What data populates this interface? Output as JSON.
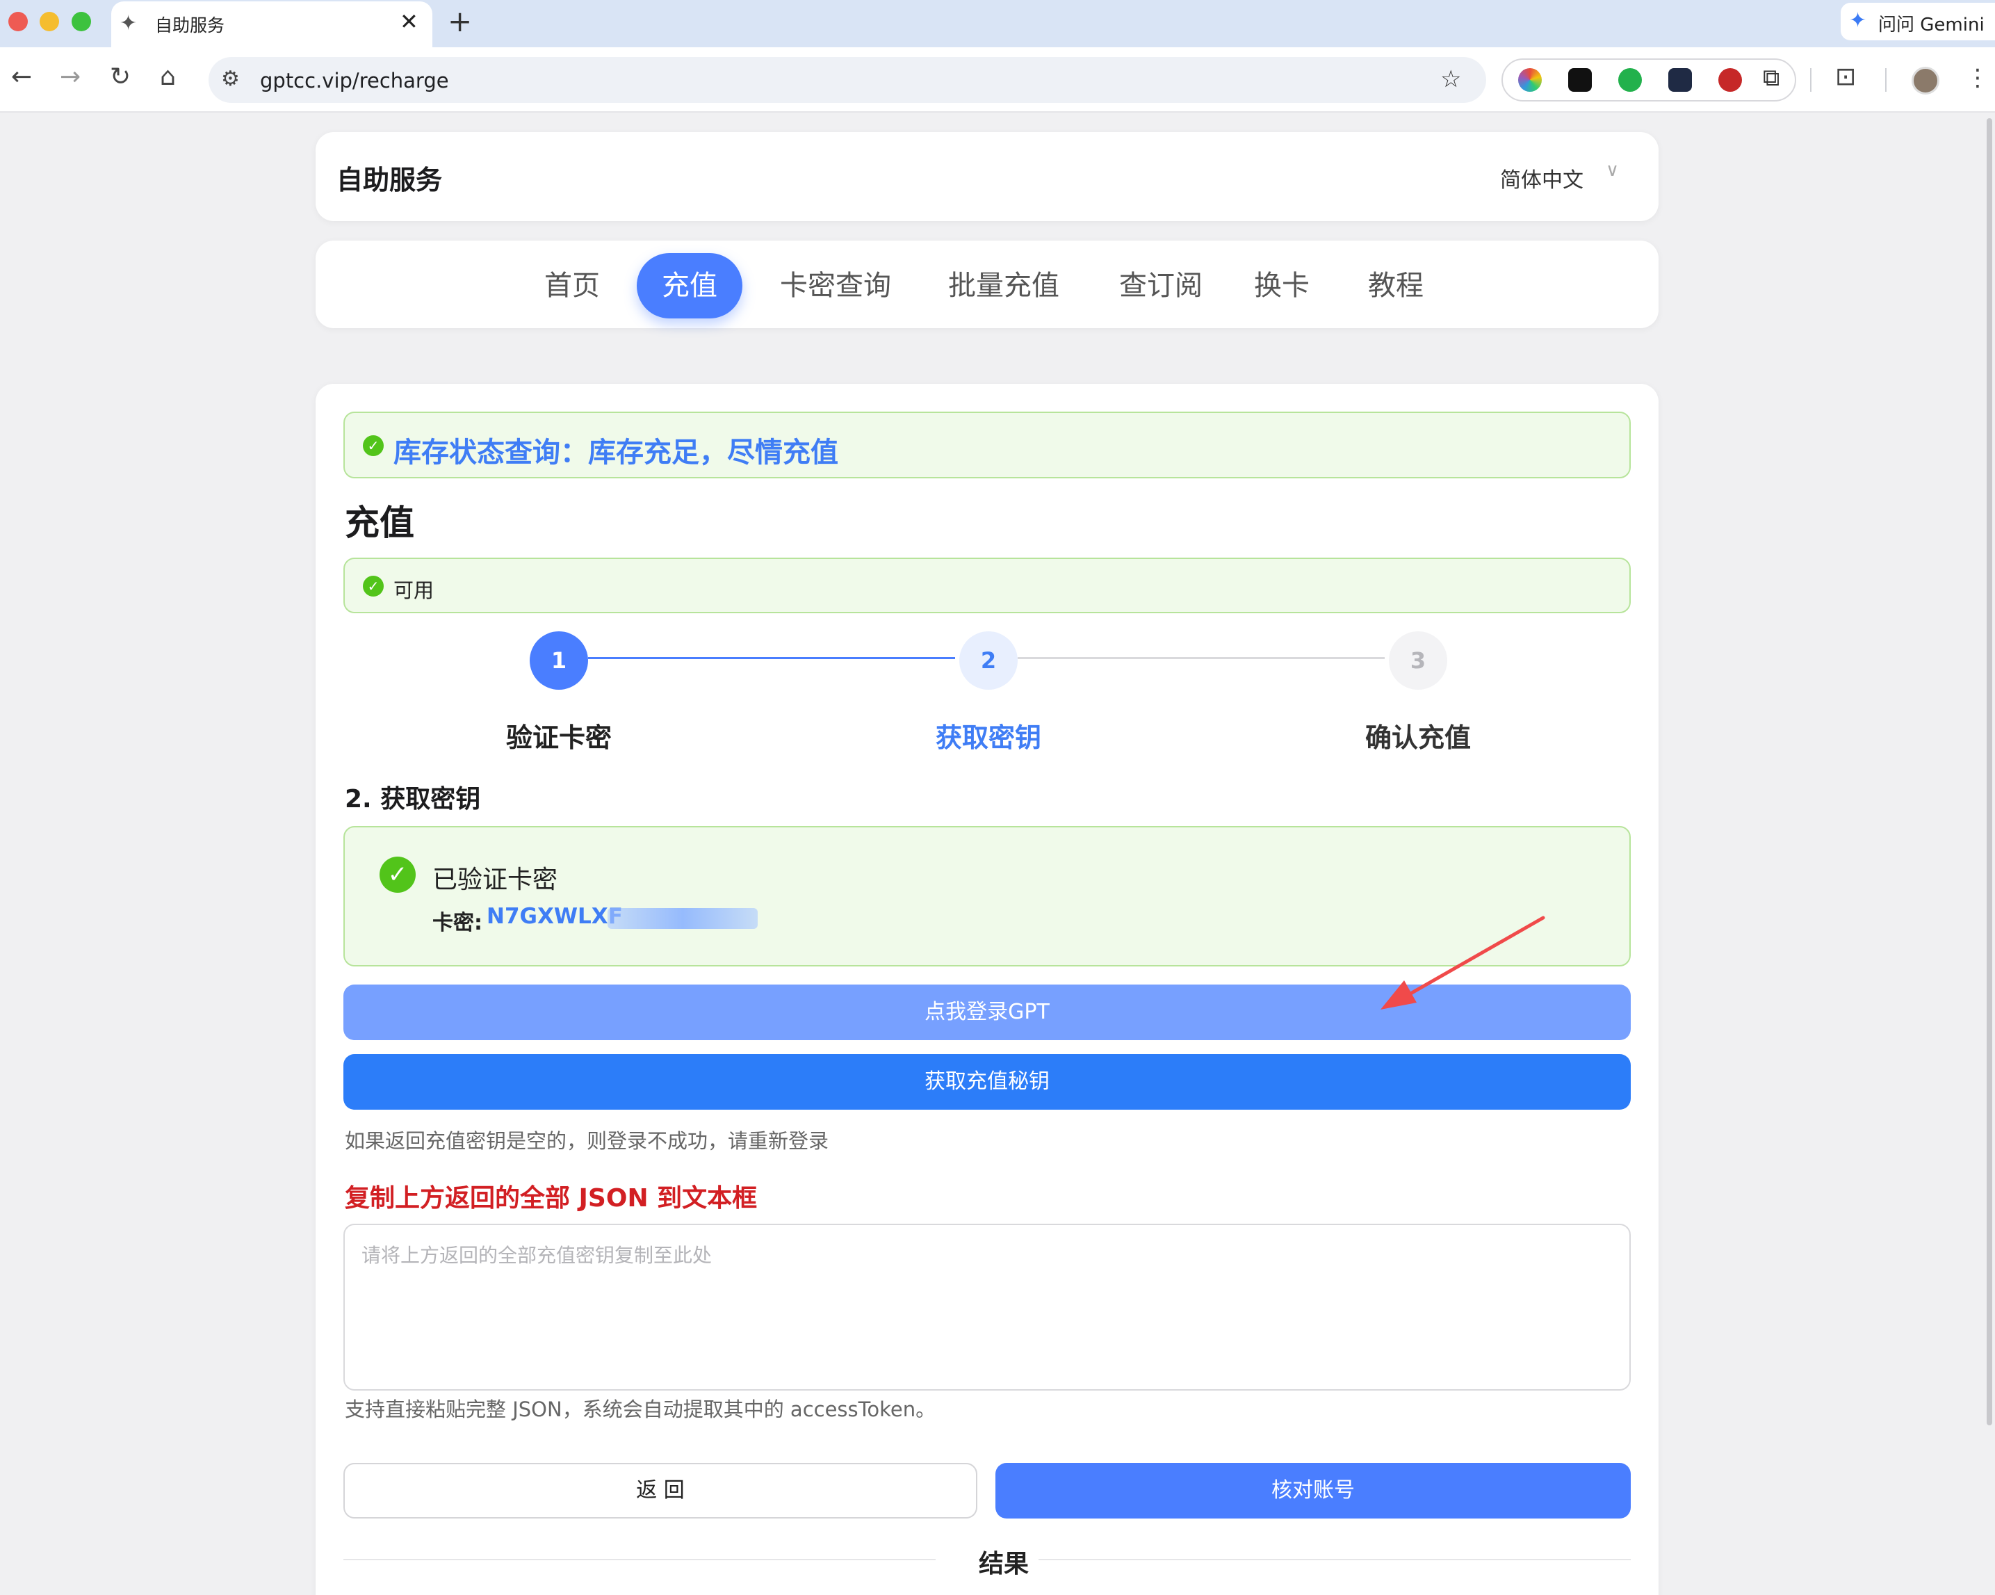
{
  "browser": {
    "tab_title": "自助服务",
    "tab_favicon": "✦",
    "close_glyph": "✕",
    "new_tab_glyph": "+",
    "gemini_label": "问问 Gemini",
    "url": "gptcc.vip/recharge",
    "icons": {
      "back": "←",
      "forward": "→",
      "reload": "↻",
      "home": "⌂",
      "site_info": "⚙",
      "bookmark": "☆",
      "extensions": "⧉",
      "reading_mode": "⊡",
      "menu": "⋮"
    }
  },
  "header": {
    "title": "自助服务",
    "language": "简体中文",
    "caret": "∨"
  },
  "nav": {
    "items": [
      "首页",
      "充值",
      "卡密查询",
      "批量充值",
      "查订阅",
      "换卡",
      "教程"
    ],
    "active_index": 1
  },
  "stock_alert": {
    "text": "库存状态查询：库存充足，尽情充值"
  },
  "section_title": "充值",
  "availability": {
    "text": "可用"
  },
  "steps": {
    "current": 2,
    "items": [
      {
        "number": "1",
        "label": "验证卡密"
      },
      {
        "number": "2",
        "label": "获取密钥"
      },
      {
        "number": "3",
        "label": "确认充值"
      }
    ]
  },
  "step_title": "2. 获取密钥",
  "verified": {
    "status": "已验证卡密",
    "card_label": "卡密:",
    "card_code": "N7GXWLXF"
  },
  "buttons": {
    "login": "点我登录GPT",
    "fetch_key": "获取充值秘钥",
    "back": "返 回",
    "verify": "核对账号"
  },
  "hint_text": "如果返回充值密钥是空的，则登录不成功，请重新登录",
  "json_instruction": "复制上方返回的全部 JSON 到文本框",
  "textarea": {
    "placeholder": "请将上方返回的全部充值密钥复制至此处",
    "value": ""
  },
  "hint_text2": "支持直接粘贴完整 JSON，系统会自动提取其中的 accessToken。",
  "result_label": "结果",
  "colors": {
    "primary": "#4a7eff",
    "success": "#52c41a",
    "warning_red": "#d21f23",
    "annotation_arrow": "#f04a4a"
  }
}
